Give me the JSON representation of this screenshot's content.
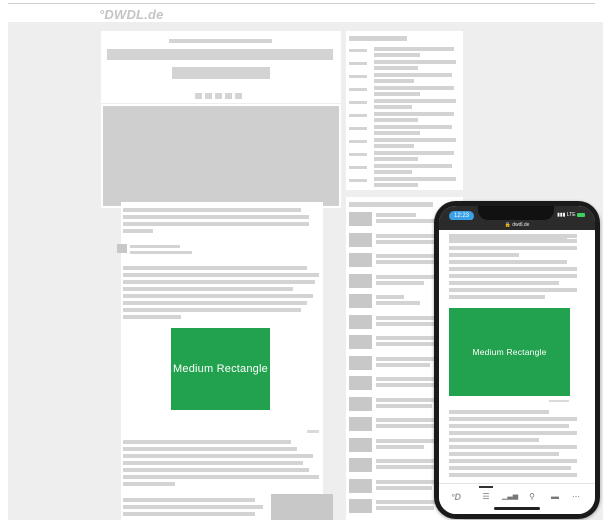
{
  "site": {
    "logo": "°DWDL.de"
  },
  "ads": {
    "desktop_label": "Medium Rectangle",
    "mobile_label": "Medium Rectangle"
  },
  "phone": {
    "time": "12:23",
    "network": "LTE",
    "url": "dwdl.de",
    "nav": {
      "logo": "°D",
      "list_icon": "list-icon",
      "chart_icon": "chart-icon",
      "search_icon": "search-icon",
      "briefcase_icon": "briefcase-icon",
      "more_icon": "more-icon"
    }
  },
  "colors": {
    "ad_green": "#22a24f",
    "placeholder_gray": "#d3d3d3",
    "background": "#eeeeee"
  }
}
